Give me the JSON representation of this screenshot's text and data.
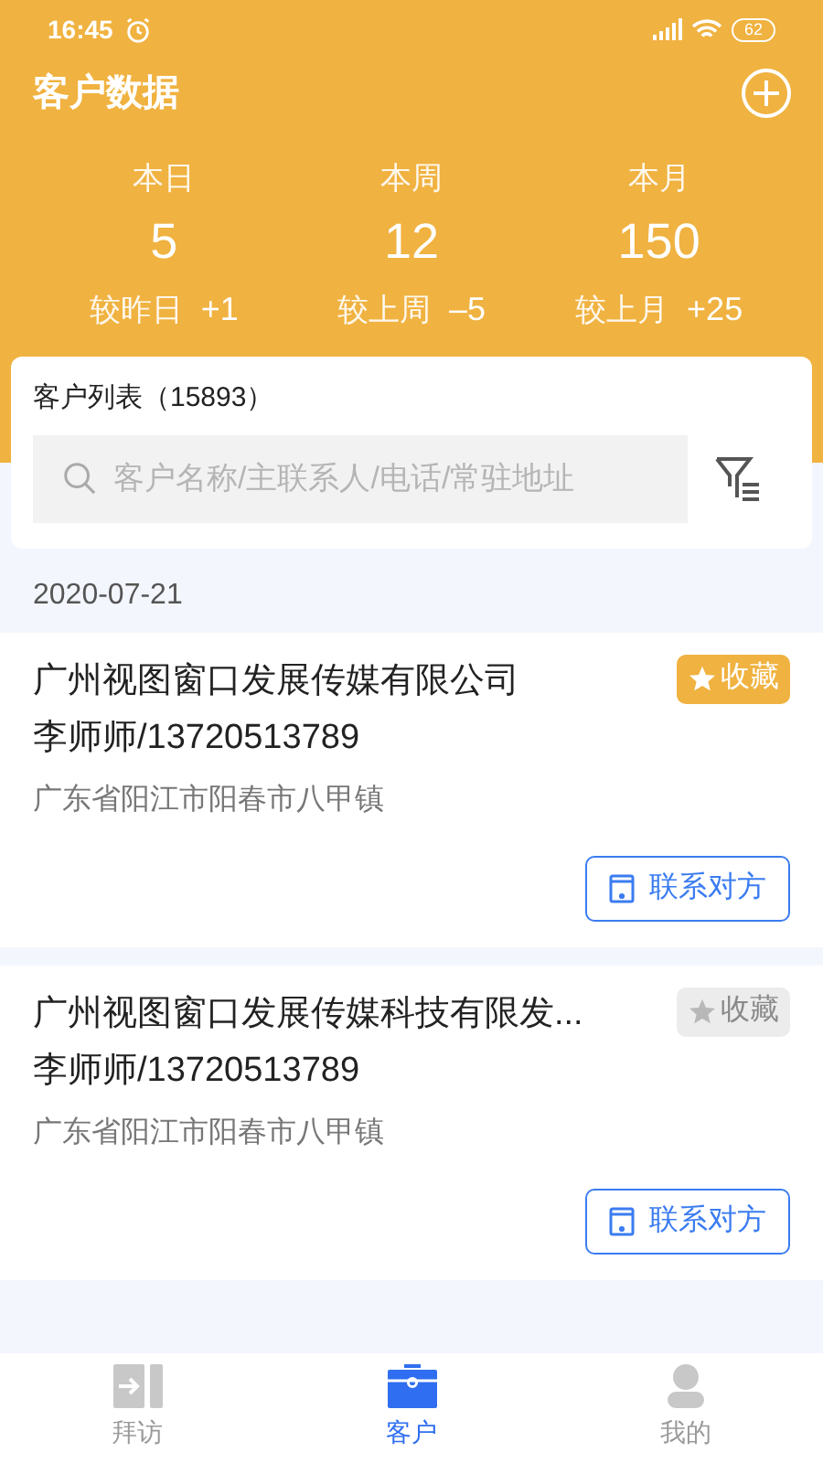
{
  "status_bar": {
    "time": "16:45",
    "battery": "62"
  },
  "header": {
    "title": "客户数据"
  },
  "stats": [
    {
      "label": "本日",
      "value": "5",
      "compare_label": "较昨日",
      "change": "+1"
    },
    {
      "label": "本周",
      "value": "12",
      "compare_label": "较上周",
      "change": "–5"
    },
    {
      "label": "本月",
      "value": "150",
      "compare_label": "较上月",
      "change": "+25"
    }
  ],
  "list_card": {
    "title": "客户列表（15893）",
    "search": {
      "placeholder": "客户名称/主联系人/电话/常驻地址"
    }
  },
  "date": "2020-07-21",
  "customers": [
    {
      "name": "广州视图窗口发展传媒有限公司",
      "contact": "李师师/13720513789",
      "address": "广东省阳江市阳春市八甲镇",
      "favorite_label": "收藏",
      "favorited": true,
      "contact_button": "联系对方"
    },
    {
      "name": "广州视图窗口发展传媒科技有限发...",
      "contact": "李师师/13720513789",
      "address": "广东省阳江市阳春市八甲镇",
      "favorite_label": "收藏",
      "favorited": false,
      "contact_button": "联系对方"
    }
  ],
  "tabs": [
    {
      "label": "拜访",
      "kind": "visit",
      "selected": false
    },
    {
      "label": "客户",
      "kind": "customer",
      "selected": true
    },
    {
      "label": "我的",
      "kind": "me",
      "selected": false
    }
  ]
}
